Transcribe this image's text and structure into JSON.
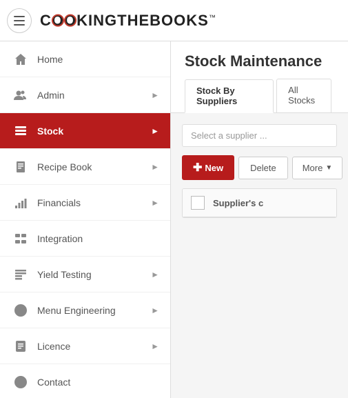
{
  "header": {
    "logo_text": "C",
    "logo_full": "COOKINGTHEBOOKS",
    "logo_tm": "™",
    "menu_icon": "menu-icon"
  },
  "sidebar": {
    "items": [
      {
        "id": "home",
        "label": "Home",
        "icon": "home-icon",
        "hasArrow": false
      },
      {
        "id": "admin",
        "label": "Admin",
        "icon": "admin-icon",
        "hasArrow": true
      },
      {
        "id": "stock",
        "label": "Stock",
        "icon": "stock-icon",
        "hasArrow": true,
        "active": true
      },
      {
        "id": "recipe-book",
        "label": "Recipe Book",
        "icon": "recipe-icon",
        "hasArrow": true
      },
      {
        "id": "financials",
        "label": "Financials",
        "icon": "financials-icon",
        "hasArrow": true
      },
      {
        "id": "integration",
        "label": "Integration",
        "icon": "integration-icon",
        "hasArrow": false
      },
      {
        "id": "yield-testing",
        "label": "Yield Testing",
        "icon": "yield-icon",
        "hasArrow": true
      },
      {
        "id": "menu-engineering",
        "label": "Menu Engineering",
        "icon": "menu-eng-icon",
        "hasArrow": true
      },
      {
        "id": "licence",
        "label": "Licence",
        "icon": "licence-icon",
        "hasArrow": true
      },
      {
        "id": "contact",
        "label": "Contact",
        "icon": "contact-icon",
        "hasArrow": false
      }
    ]
  },
  "content": {
    "page_title": "Stock Maintenance",
    "tabs": [
      {
        "id": "by-suppliers",
        "label": "Stock By Suppliers",
        "active": true
      },
      {
        "id": "all-stocks",
        "label": "All Stocks",
        "active": false
      }
    ],
    "supplier_placeholder": "Select a supplier ...",
    "toolbar": {
      "new_label": "New",
      "delete_label": "Delete",
      "more_label": "More"
    },
    "table": {
      "col_header": "Supplier's c"
    }
  },
  "colors": {
    "accent": "#b71c1c",
    "active_bg": "#b71c1c",
    "sidebar_bg": "#ffffff",
    "header_bg": "#ffffff"
  }
}
